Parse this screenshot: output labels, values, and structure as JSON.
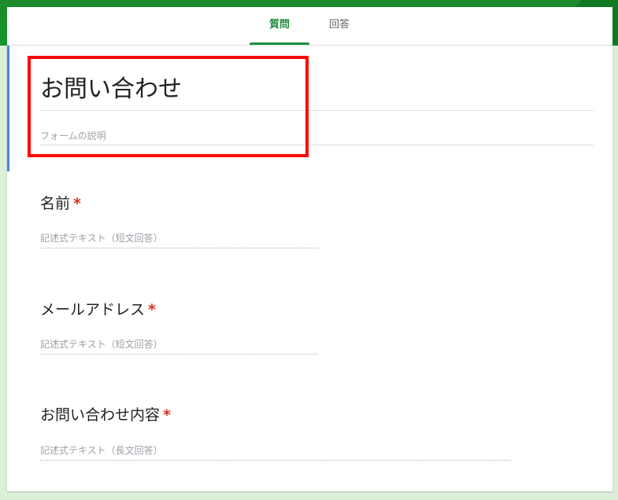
{
  "tabs": [
    {
      "label": "質問",
      "active": true
    },
    {
      "label": "回答",
      "active": false
    }
  ],
  "form": {
    "title": "お問い合わせ",
    "description_placeholder": "フォームの説明"
  },
  "questions": [
    {
      "title": "名前",
      "required_mark": "*",
      "answer_placeholder": "記述式テキスト（短文回答）"
    },
    {
      "title": "メールアドレス",
      "required_mark": "*",
      "answer_placeholder": "記述式テキスト（短文回答）"
    },
    {
      "title": "お問い合わせ内容",
      "required_mark": "*",
      "answer_placeholder": "記述式テキスト（長文回答）"
    }
  ],
  "colors": {
    "accent_green": "#1e8e3e",
    "header_green": "#14962b",
    "highlight_red": "#ff0000",
    "required_red": "#d93025",
    "section_accent_blue": "#4285f4"
  }
}
